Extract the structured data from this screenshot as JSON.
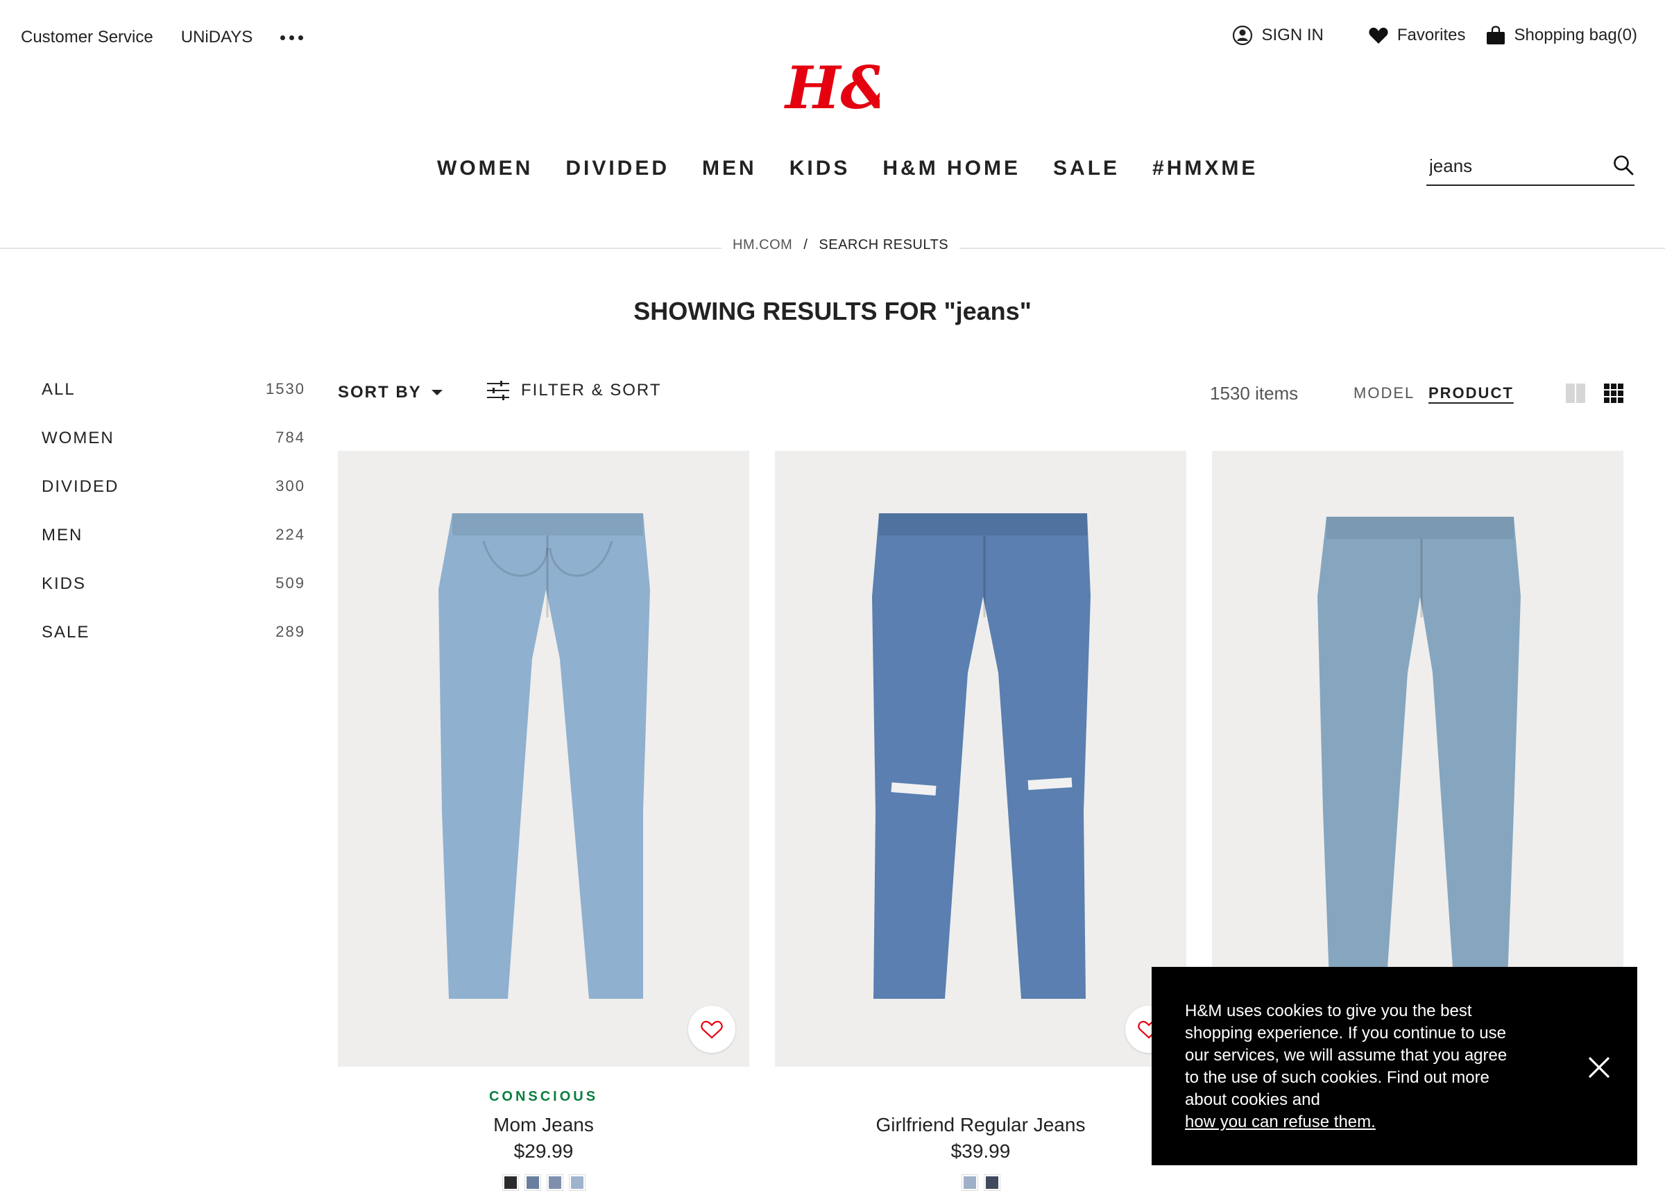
{
  "utility": {
    "customer_service": "Customer Service",
    "unidays": "UNiDAYS",
    "sign_in": "SIGN IN",
    "favorites": "Favorites",
    "shopping_bag": "Shopping bag(0)"
  },
  "logo_text": "H&M",
  "nav": [
    "WOMEN",
    "DIVIDED",
    "MEN",
    "KIDS",
    "H&M HOME",
    "SALE",
    "#HMXME"
  ],
  "search": {
    "value": "jeans"
  },
  "breadcrumb": {
    "home": "HM.COM",
    "separator": "/",
    "current": "SEARCH RESULTS"
  },
  "page_title": "SHOWING RESULTS FOR \"jeans\"",
  "categories": [
    {
      "label": "ALL",
      "count": "1530"
    },
    {
      "label": "WOMEN",
      "count": "784"
    },
    {
      "label": "DIVIDED",
      "count": "300"
    },
    {
      "label": "MEN",
      "count": "224"
    },
    {
      "label": "KIDS",
      "count": "509"
    },
    {
      "label": "SALE",
      "count": "289"
    }
  ],
  "toolbar": {
    "sort_by": "SORT BY",
    "filter_sort": "FILTER & SORT",
    "item_count": "1530 items",
    "view_model": "MODEL",
    "view_product": "PRODUCT"
  },
  "products": [
    {
      "tag": "CONSCIOUS",
      "name": "Mom Jeans",
      "price": "$29.99",
      "denim": "#8fb0cf",
      "swatches": [
        "#2b2b2b",
        "#6a7fa0",
        "#7f8fae",
        "#9fb3cc"
      ]
    },
    {
      "tag": "",
      "name": "Girlfriend Regular Jeans",
      "price": "$39.99",
      "denim": "#5a7fb0",
      "swatches": [
        "#9fb0c8",
        "#3f4a5e"
      ]
    },
    {
      "tag": "",
      "name": "",
      "price": "",
      "denim": "#86a6bf",
      "swatches": [
        "#2b2b2b",
        "#6a7fa0",
        "#7f8fae",
        "#9fb3cc"
      ]
    }
  ],
  "cookie": {
    "message": "H&M uses cookies to give you the best shopping experience. If you continue to use our services, we will assume that you agree to the use of such cookies. Find out more about cookies and",
    "link": "how you can refuse them."
  },
  "colors": {
    "brand_red": "#e50010",
    "conscious_green": "#0a7e3f"
  }
}
